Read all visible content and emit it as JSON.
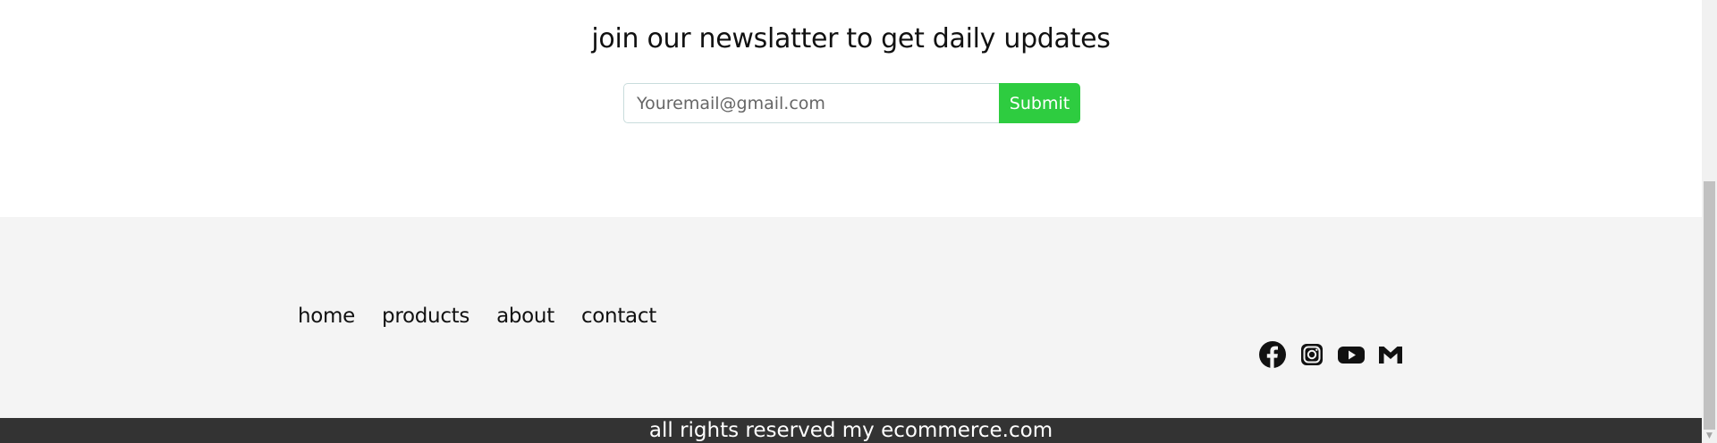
{
  "newsletter": {
    "title": "join our newslatter to get daily updates",
    "email_placeholder": "Youremail@gmail.com",
    "email_value": "",
    "submit_label": "Submit",
    "submit_color": "#2ecc40"
  },
  "footer": {
    "nav": [
      {
        "label": "home"
      },
      {
        "label": "products"
      },
      {
        "label": "about"
      },
      {
        "label": "contact"
      }
    ],
    "social_icons": [
      "facebook-icon",
      "instagram-icon",
      "youtube-icon",
      "gmail-icon"
    ],
    "background": "#f4f4f4",
    "copyright": "all rights reserved my ecommerce.com",
    "copyright_background": "#333333"
  },
  "scrollbar": {
    "down_arrow": "▼"
  }
}
